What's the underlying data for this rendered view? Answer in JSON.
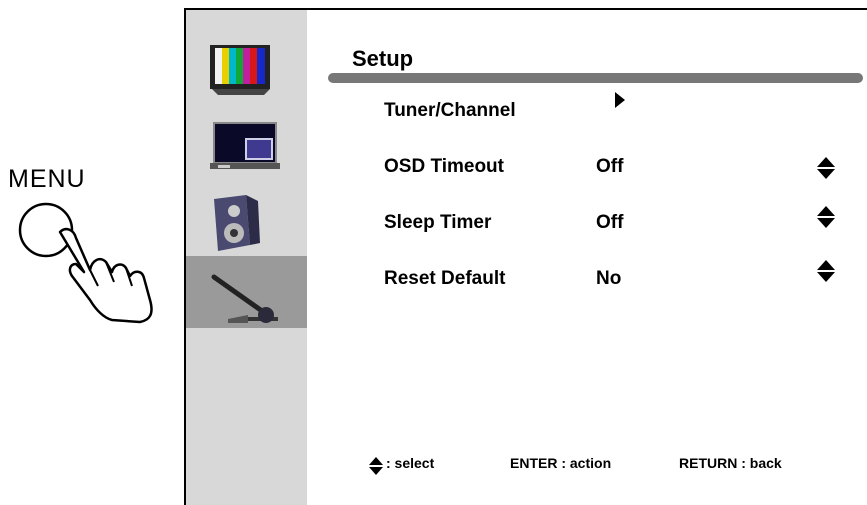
{
  "menu_button": {
    "label": "MENU"
  },
  "osd": {
    "sidebar": {
      "items": [
        {
          "icon": "picture-icon"
        },
        {
          "icon": "screen-icon"
        },
        {
          "icon": "audio-speaker-icon"
        },
        {
          "icon": "setup-wrench-icon",
          "active": true
        }
      ]
    },
    "title": "Setup",
    "rows": [
      {
        "label": "Tuner/Channel",
        "value": "",
        "control": "submenu-arrow"
      },
      {
        "label": "OSD Timeout",
        "value": "Off",
        "control": "up-down"
      },
      {
        "label": "Sleep Timer",
        "value": "Off",
        "control": "up-down"
      },
      {
        "label": "Reset Default",
        "value": "No",
        "control": "up-down"
      }
    ],
    "footer": {
      "select": ": select",
      "enter": "ENTER : action",
      "return": "RETURN : back"
    }
  }
}
